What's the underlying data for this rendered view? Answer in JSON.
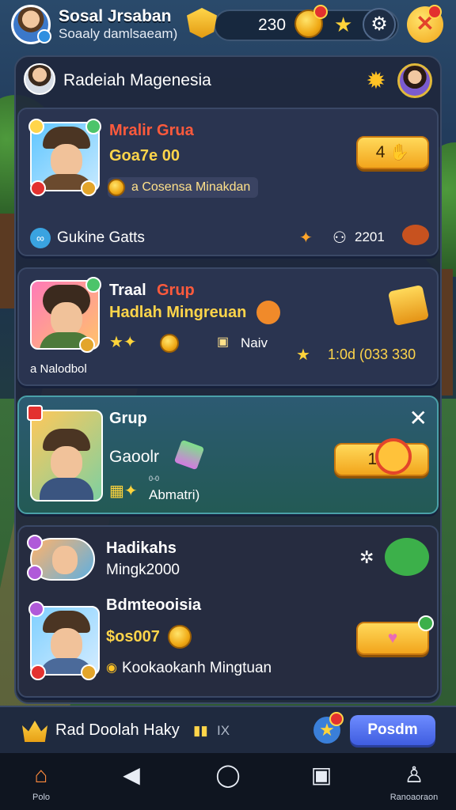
{
  "header": {
    "user_name": "Sosal Jrsaban",
    "user_sub": "Soaaly damlsaeam)",
    "coin_count": "230"
  },
  "panel": {
    "title": "Radeiah Magenesia"
  },
  "cards": [
    {
      "title": "Mralir Grua",
      "subtitle": "Goa7e 00",
      "chip": "a Cosensa Minakdan",
      "footer": "Gukine Gatts",
      "button": "4",
      "stat": "2201"
    },
    {
      "title_a": "Traal",
      "title_b": "Grup",
      "subtitle": "Hadlah Mingreuan",
      "detail": "Naiv",
      "footer": "a Nalodbol",
      "right_value": "1:0d (033 330"
    },
    {
      "title": "Grup",
      "subtitle": "Gaoolr",
      "detail": "Abmatri)",
      "detail_small": "0-0",
      "button": "150"
    },
    {
      "title": "Hadikahs",
      "subtitle": "Mingk2000"
    },
    {
      "title": "Bdmteooisia",
      "subtitle": "$os007",
      "detail": "Kookaokanh Mingtuan"
    }
  ],
  "action_bar": {
    "text": "Rad Doolah Haky",
    "extra": "IX",
    "button": "Posdm"
  },
  "nav": [
    {
      "label": "Polo"
    },
    {
      "label": ""
    },
    {
      "label": ""
    },
    {
      "label": ""
    },
    {
      "label": "Ranoaoraon"
    }
  ],
  "colors": {
    "gold": "#ffd54a",
    "red_title": "#ff5a3c",
    "accent_blue": "#4f6cf0",
    "panel_bg": "#1f273c"
  }
}
